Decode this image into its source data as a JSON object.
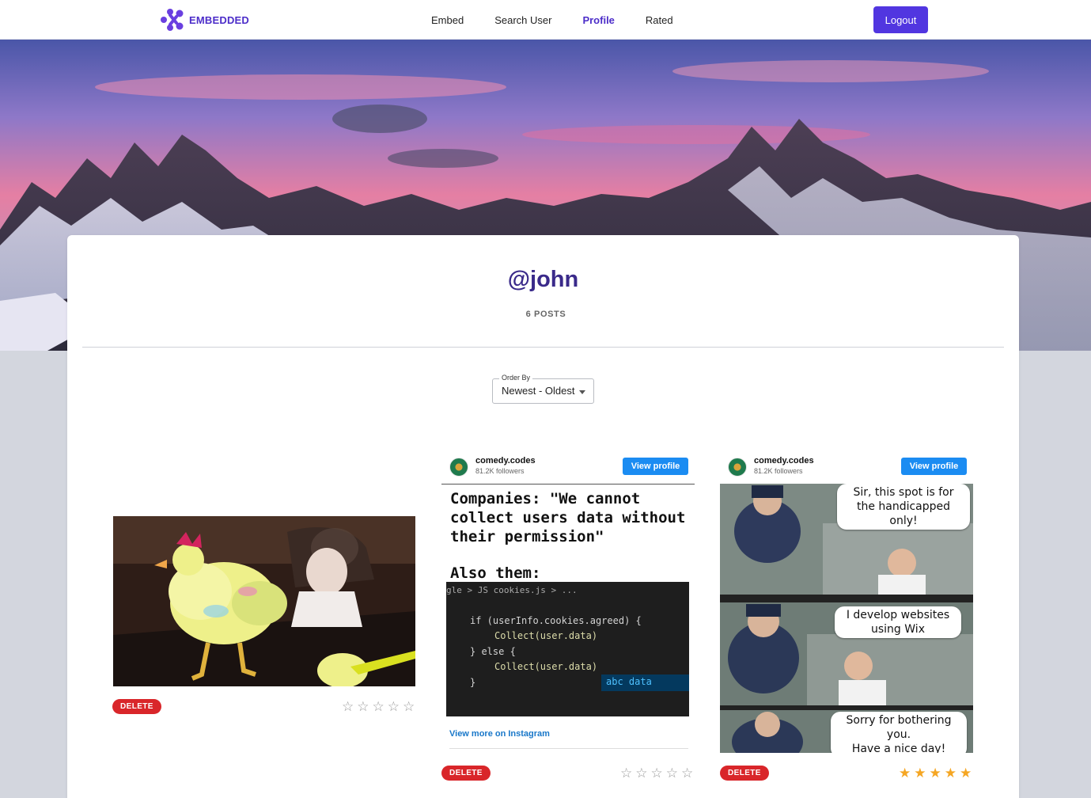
{
  "nav": {
    "brand": "EMBEDDED",
    "links": [
      "Embed",
      "Search User",
      "Profile",
      "Rated"
    ],
    "active": "Profile",
    "logout": "Logout"
  },
  "profile": {
    "username": "@john",
    "posts_count": "6 POSTS"
  },
  "order": {
    "label": "Order By",
    "value": "Newest - Oldest"
  },
  "posts": [
    {
      "type": "gif",
      "delete_label": "DELETE",
      "rating": 0
    },
    {
      "type": "instagram",
      "account": "comedy.codes",
      "followers": "81.2K followers",
      "view_profile": "View profile",
      "meme_text": "Companies: \"We cannot\ncollect users data without\ntheir permission\"",
      "meme_text2": "Also them:",
      "code": {
        "crumb": "gle > JS cookies.js > ...",
        "line1": "if (userInfo.cookies.agreed) {",
        "line2": "Collect(user.data)",
        "line3": "} else {",
        "line4": "Collect(user.data)",
        "line5": "}",
        "suggestion": "abc data"
      },
      "view_more": "View more on Instagram",
      "delete_label": "DELETE",
      "rating": 0
    },
    {
      "type": "instagram",
      "account": "comedy.codes",
      "followers": "81.2K followers",
      "view_profile": "View profile",
      "bubbles": [
        "Sir, this spot is for\nthe handicapped only!",
        "I develop websites\nusing Wix",
        "Sorry for bothering you.\nHave a nice day!"
      ],
      "delete_label": "DELETE",
      "rating": 5
    }
  ],
  "colors": {
    "accent": "#5136e0",
    "brand": "#4c2dc9",
    "delete": "#d9262a",
    "star_filled": "#f5a623",
    "ig_button": "#1b8cf2"
  }
}
